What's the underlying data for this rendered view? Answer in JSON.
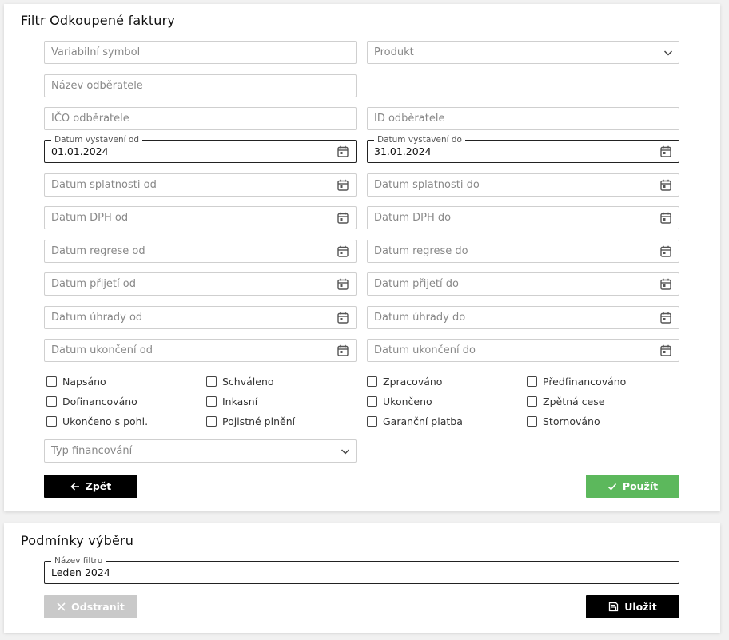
{
  "filter": {
    "title": "Filtr Odkoupené faktury",
    "variable_symbol": {
      "placeholder": "Variabilní symbol"
    },
    "product": {
      "placeholder": "Produkt"
    },
    "customer_name": {
      "placeholder": "Název odběratele"
    },
    "customer_ico": {
      "placeholder": "IČO odběratele"
    },
    "customer_id": {
      "placeholder": "ID odběratele"
    },
    "issued_from": {
      "label": "Datum vystavení od",
      "value": "01.01.2024"
    },
    "issued_to": {
      "label": "Datum vystavení do",
      "value": "31.01.2024"
    },
    "due_from": {
      "placeholder": "Datum splatnosti od"
    },
    "due_to": {
      "placeholder": "Datum splatnosti do"
    },
    "vat_from": {
      "placeholder": "Datum DPH od"
    },
    "vat_to": {
      "placeholder": "Datum DPH do"
    },
    "recourse_from": {
      "placeholder": "Datum regrese od"
    },
    "recourse_to": {
      "placeholder": "Datum regrese do"
    },
    "received_from": {
      "placeholder": "Datum přijetí od"
    },
    "received_to": {
      "placeholder": "Datum přijetí do"
    },
    "paid_from": {
      "placeholder": "Datum úhrady od"
    },
    "paid_to": {
      "placeholder": "Datum úhrady do"
    },
    "ended_from": {
      "placeholder": "Datum ukončení od"
    },
    "ended_to": {
      "placeholder": "Datum ukončení do"
    },
    "checkboxes": [
      "Napsáno",
      "Schváleno",
      "Zpracováno",
      "Předfinancováno",
      "Dofinancováno",
      "Inkasní",
      "Ukončeno",
      "Zpětná cese",
      "Ukončeno s pohl.",
      "Pojistné plnění",
      "Garanční platba",
      "Stornováno"
    ],
    "financing_type": {
      "placeholder": "Typ financování"
    },
    "back_label": "Zpět",
    "apply_label": "Použít"
  },
  "conditions": {
    "title": "Podmínky výběru",
    "filter_name": {
      "label": "Název filtru",
      "value": "Leden 2024"
    },
    "remove_label": "Odstranit",
    "save_label": "Uložit"
  },
  "colors": {
    "apply": "#5cb85c",
    "dark": "#000000",
    "disabled": "#c9c9c9"
  }
}
